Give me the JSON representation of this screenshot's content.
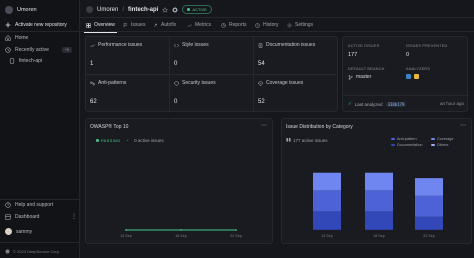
{
  "sidebar": {
    "org_name": "Umoren",
    "activate_label": "Activate new repository",
    "home_label": "Home",
    "recently_active_label": "Recently active",
    "recently_active_key": "^K",
    "repo_item": "fintech-api",
    "help_label": "Help and support",
    "dashboard_label": "Dashboard",
    "user_name": "sammy",
    "footer_text": "© 2023 DeepSource Corp."
  },
  "header": {
    "owner": "Umoren",
    "separator": "/",
    "repo": "fintech-api",
    "status_badge": "ACTIVE"
  },
  "tabs": [
    {
      "label": "Overview",
      "icon": "grid-icon",
      "active": true
    },
    {
      "label": "Issues",
      "icon": "flag-icon",
      "active": false
    },
    {
      "label": "Autofix",
      "icon": "autofix-icon",
      "active": false
    },
    {
      "label": "Metrics",
      "icon": "metrics-icon",
      "active": false
    },
    {
      "label": "Reports",
      "icon": "reports-icon",
      "active": false
    },
    {
      "label": "History",
      "icon": "history-icon",
      "active": false
    },
    {
      "label": "Settings",
      "icon": "gear-icon",
      "active": false
    }
  ],
  "metrics": [
    {
      "label": "Performance issues",
      "value": "1",
      "icon": "performance-icon"
    },
    {
      "label": "Style issues",
      "value": "0",
      "icon": "style-icon"
    },
    {
      "label": "Documentation issues",
      "value": "54",
      "icon": "documentation-icon"
    },
    {
      "label": "Anti-patterns",
      "value": "62",
      "icon": "antipattern-icon"
    },
    {
      "label": "Security issues",
      "value": "0",
      "icon": "security-icon"
    },
    {
      "label": "Coverage issues",
      "value": "52",
      "icon": "coverage-icon"
    }
  ],
  "summary": {
    "active_issues_label": "ACTIVE ISSUES",
    "active_issues_value": "177",
    "issues_prevented_label": "ISSUES PREVENTED",
    "issues_prevented_value": "0",
    "default_branch_label": "DEFAULT BRANCH",
    "default_branch_value": "master",
    "analyzers_label": "ANALYZERS",
    "last_analyzed_label": "Last analyzed",
    "commit_hash": "338b179",
    "last_analyzed_time": "an hour ago"
  },
  "owasp": {
    "title": "OWASP® Top 10",
    "status": "PASSING",
    "active_issues": "0 active issues"
  },
  "colors": {
    "bar_top": "#6f86f0",
    "bar_mid": "#4c62d6",
    "bar_low": "#3248b8",
    "bar_bottom": "#233690",
    "passing": "#47c98b"
  },
  "chart_data": [
    {
      "type": "line",
      "x": [
        "14 Sep",
        "18 Sep",
        "22 Sep"
      ],
      "series": [
        {
          "values": [
            0,
            0,
            0
          ]
        }
      ],
      "title": "OWASP® Top 10",
      "grid": false
    },
    {
      "type": "bar",
      "title": "Issue Distribution by Category",
      "subtitle": "177 active issues",
      "categories": [
        "14 Sep",
        "18 Sep",
        "22 Sep"
      ],
      "series": [
        {
          "name": "Anti-pattern",
          "values": [
            62,
            62,
            62
          ]
        },
        {
          "name": "Coverage",
          "values": [
            52,
            52,
            52
          ]
        },
        {
          "name": "Documentation",
          "values": [
            54,
            54,
            38
          ]
        },
        {
          "name": "Others",
          "values": [
            1,
            1,
            1
          ]
        }
      ],
      "stacked": true,
      "legend": "top-right"
    }
  ]
}
